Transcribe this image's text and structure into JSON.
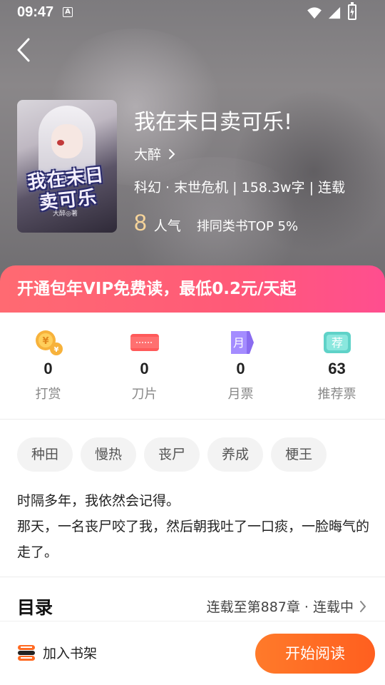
{
  "status_bar": {
    "time": "09:47",
    "a_icon_label": "A"
  },
  "book": {
    "title": "我在末日卖可乐!",
    "author": "大醉",
    "meta": "科幻 · 末世危机 | 158.3w字 | 连载",
    "popularity_value": "8",
    "popularity_label": "人气",
    "rank_text": "排同类书TOP 5%",
    "cover_title": "我在末日卖可乐",
    "cover_author": "大醉◎著"
  },
  "vip_banner": {
    "text": "开通包年VIP免费读，最低0.2元/天起"
  },
  "stats": [
    {
      "icon": "coin-icon",
      "value": "0",
      "label": "打赏"
    },
    {
      "icon": "blade-icon",
      "value": "0",
      "label": "刀片"
    },
    {
      "icon": "monthly-ticket-icon",
      "value": "0",
      "label": "月票",
      "icon_text": "月"
    },
    {
      "icon": "recommend-ticket-icon",
      "value": "63",
      "label": "推荐票",
      "icon_text": "荐"
    }
  ],
  "tags": [
    "种田",
    "慢热",
    "丧尸",
    "养成",
    "梗王"
  ],
  "description": {
    "line1": "时隔多年，我依然会记得。",
    "line2": "那天，一名丧尸咬了我，然后朝我吐了一口痰，一脸晦气的走了。"
  },
  "toc": {
    "title": "目录",
    "status": "连载至第887章 · 连载中"
  },
  "bottom_bar": {
    "shelf_label": "加入书架",
    "read_label": "开始阅读"
  },
  "colors": {
    "accent_orange": "#ff6a22",
    "vip_pink": "#ff5a78",
    "popularity_gold": "#f6d49a"
  }
}
